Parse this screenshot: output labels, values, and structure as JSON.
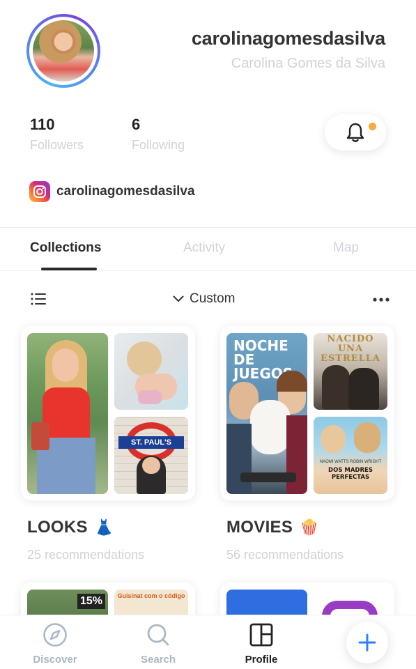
{
  "profile": {
    "username": "carolinagomesdasilva",
    "full_name": "Carolina Gomes da Silva",
    "followers_count": "110",
    "followers_label": "Followers",
    "following_count": "6",
    "following_label": "Following",
    "instagram_handle": "carolinagomesdasilva",
    "notification_dot_color": "#f7a93a"
  },
  "tabs": [
    {
      "label": "Collections",
      "active": true
    },
    {
      "label": "Activity",
      "active": false
    },
    {
      "label": "Map",
      "active": false
    }
  ],
  "toolbar": {
    "sort_label": "Custom",
    "icons": [
      "list-view-icon",
      "chevron-down-icon",
      "more-options-icon"
    ]
  },
  "collections": [
    {
      "title": "LOOKS",
      "emoji": "👗",
      "count_label": "25 recommendations"
    },
    {
      "title": "MOVIES",
      "emoji": "🍿",
      "count_label": "56 recommendations"
    }
  ],
  "posters": {
    "noche": "NOCHE DE JUEGOS",
    "nacido": "NACIDO UNA ESTRELLA",
    "madres": "DOS MADRES PERFECTAS",
    "madres_credits": "NAOMI WATTS    ROBIN WRIGHT",
    "stpauls": "ST. PAUL'S",
    "promo_pct": "15%",
    "promo_text": "Guisinat com o código"
  },
  "bottom_nav": [
    {
      "label": "Discover",
      "icon": "compass-icon",
      "active": false
    },
    {
      "label": "Search",
      "icon": "search-icon",
      "active": false
    },
    {
      "label": "Profile",
      "icon": "profile-grid-icon",
      "active": true
    }
  ],
  "fab_icon": "plus-icon",
  "colors": {
    "accent": "#2d7ff9",
    "muted": "#cfd2d8",
    "nav_inactive": "#a9b7c6"
  }
}
